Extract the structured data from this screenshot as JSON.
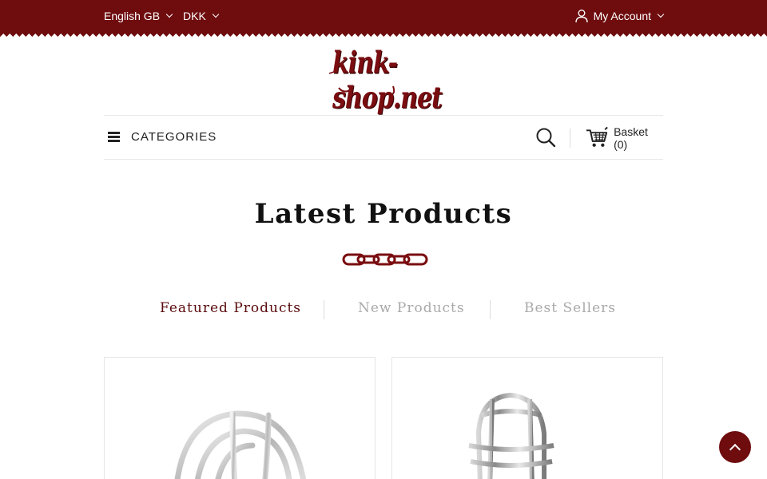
{
  "topbar": {
    "language": "English GB",
    "currency": "DKK",
    "account": "My Account"
  },
  "logo": {
    "text": "kink-shop.net"
  },
  "nav": {
    "categories": "CATEGORIES",
    "basket": "Basket (0)"
  },
  "section": {
    "title": "Latest Products",
    "tabs": [
      "Featured Products",
      "New Products",
      "Best Sellers"
    ],
    "active_tab": "Featured Products"
  },
  "colors": {
    "brand": "#6e0c0e",
    "active_tab": "#5a0a0c",
    "inactive_tab": "#a9a9a9"
  },
  "icons": {
    "user": "user-icon",
    "search": "search-icon",
    "basket": "shopping-cart-icon",
    "menu": "hamburger-icon",
    "back_to_top": "chevron-up-icon"
  }
}
